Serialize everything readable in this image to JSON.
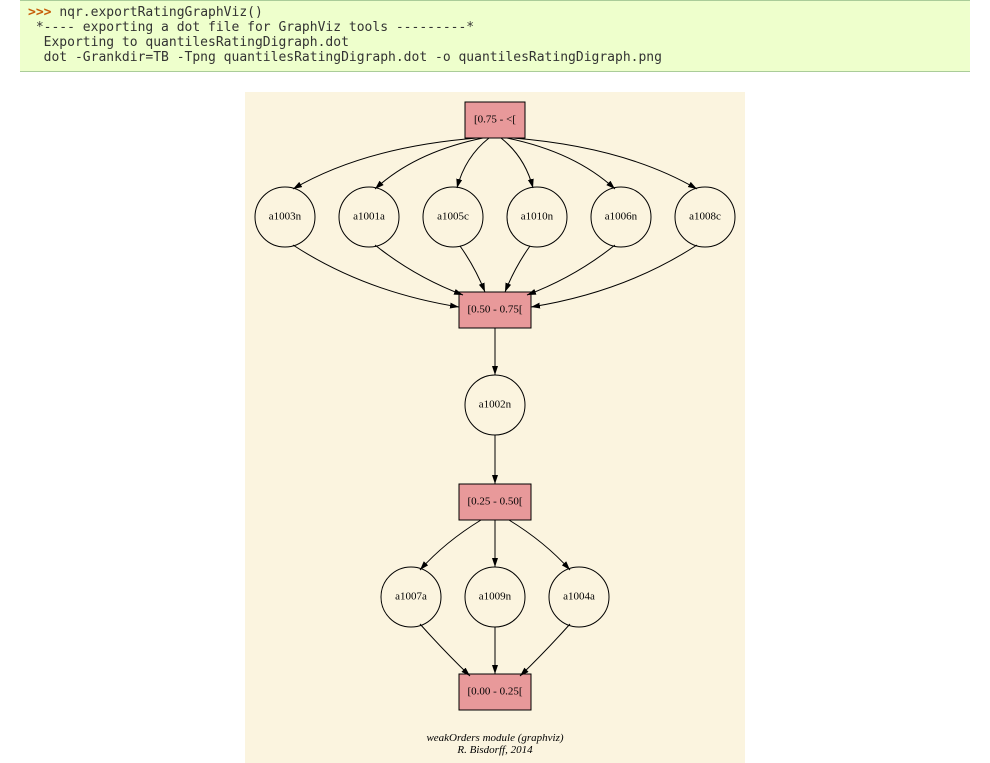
{
  "code": {
    "prompt": ">>> ",
    "command": "nqr.exportRatingGraphViz()",
    "out1": " *---- exporting a dot file for GraphViz tools ---------*",
    "out2": "  Exporting to quantilesRatingDigraph.dot",
    "out3": "  dot -Grankdir=TB -Tpng quantilesRatingDigraph.dot -o quantilesRatingDigraph.png"
  },
  "graph": {
    "quantiles": {
      "q075": "[0.75 - <[",
      "q050": "[0.50 - 0.75[",
      "q025": "[0.25 - 0.50[",
      "q000": "[0.00 - 0.25["
    },
    "row1": {
      "n0": "a1003n",
      "n1": "a1001a",
      "n2": "a1005c",
      "n3": "a1010n",
      "n4": "a1006n",
      "n5": "a1008c"
    },
    "row2": {
      "n0": "a1002n"
    },
    "row3": {
      "n0": "a1007a",
      "n1": "a1009n",
      "n2": "a1004a"
    }
  },
  "caption": {
    "line1": "weakOrders module (graphviz)",
    "line2": "R. Bisdorff, 2014"
  }
}
